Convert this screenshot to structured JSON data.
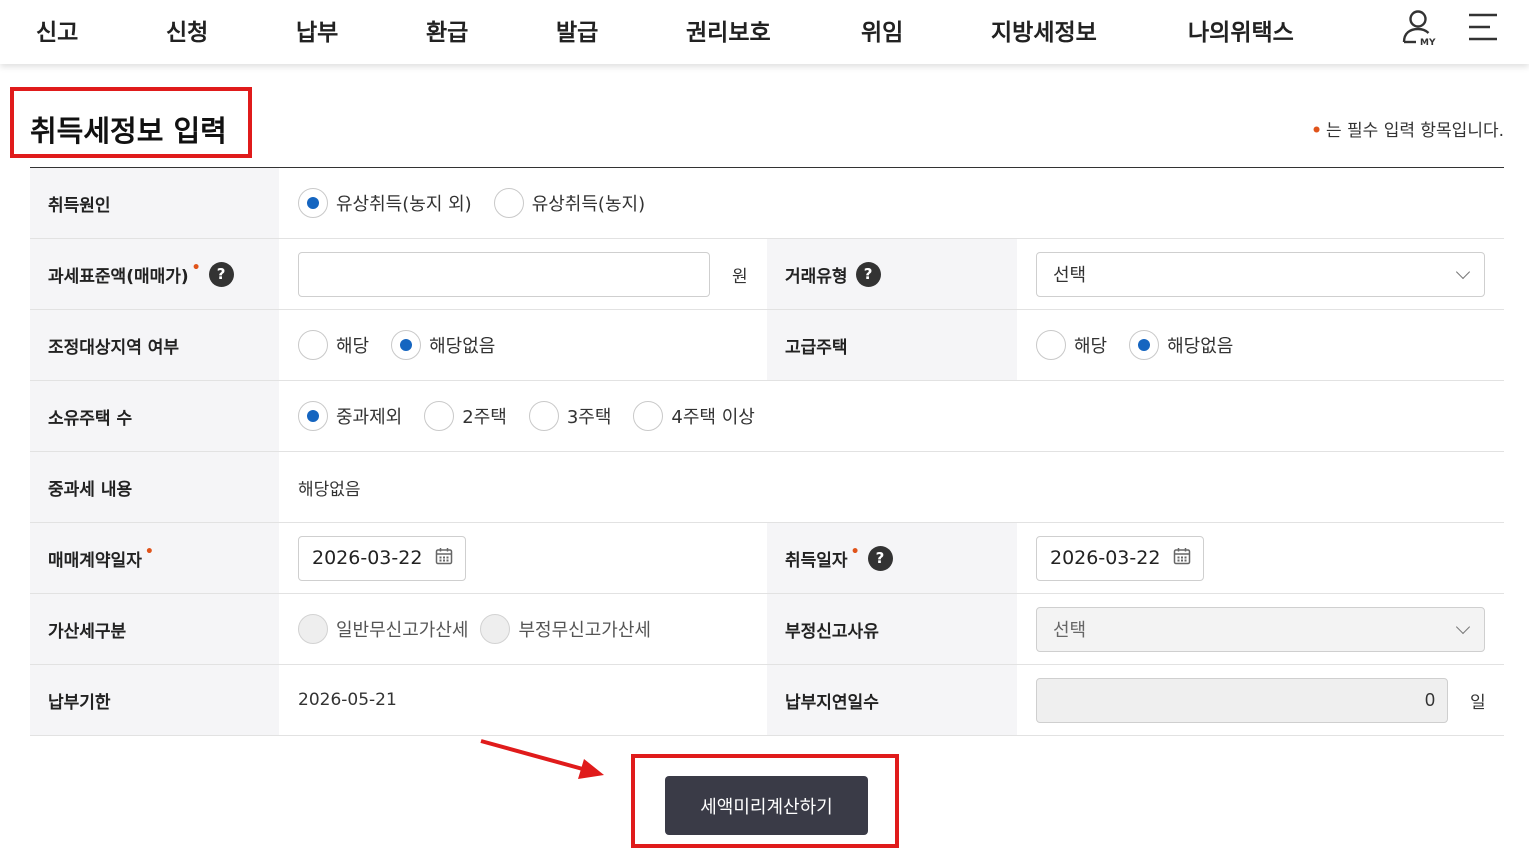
{
  "nav": {
    "items": [
      "신고",
      "신청",
      "납부",
      "환급",
      "발급",
      "권리보호",
      "위임",
      "지방세정보",
      "나의위택스"
    ],
    "my_label": "MY"
  },
  "page": {
    "title": "취득세정보 입력",
    "required_note": "는 필수 입력 항목입니다.",
    "required_mark": "•"
  },
  "form": {
    "acq_cause": {
      "label": "취득원인",
      "options": [
        "유상취득(농지 외)",
        "유상취득(농지)"
      ],
      "selected": 0
    },
    "tax_base": {
      "label": "과세표준액(매매가)",
      "value": "",
      "unit": "원"
    },
    "deal_type": {
      "label": "거래유형",
      "selected": "선택"
    },
    "adj_area": {
      "label": "조정대상지역 여부",
      "options": [
        "해당",
        "해당없음"
      ],
      "selected": 1
    },
    "luxury_house": {
      "label": "고급주택",
      "options": [
        "해당",
        "해당없음"
      ],
      "selected": 1
    },
    "houses_owned": {
      "label": "소유주택 수",
      "options": [
        "중과제외",
        "2주택",
        "3주택",
        "4주택 이상"
      ],
      "selected": 0
    },
    "heavy_tax": {
      "label": "중과세 내용",
      "value": "해당없음"
    },
    "contract_date": {
      "label": "매매계약일자",
      "value": "2026-03-22"
    },
    "acq_date": {
      "label": "취득일자",
      "value": "2026-03-22"
    },
    "penalty_type": {
      "label": "가산세구분",
      "options": [
        "일반무신고가산세",
        "부정무신고가산세"
      ]
    },
    "improper_reason": {
      "label": "부정신고사유",
      "selected": "선택"
    },
    "due_date": {
      "label": "납부기한",
      "value": "2026-05-21"
    },
    "late_days": {
      "label": "납부지연일수",
      "value": "0",
      "unit": "일"
    }
  },
  "actions": {
    "calc_label": "세액미리계산하기"
  },
  "colors": {
    "accent_blue": "#1565c0",
    "required_red": "#e0541b",
    "highlight_red": "#e01b1b",
    "button_dark": "#3a3b47"
  }
}
